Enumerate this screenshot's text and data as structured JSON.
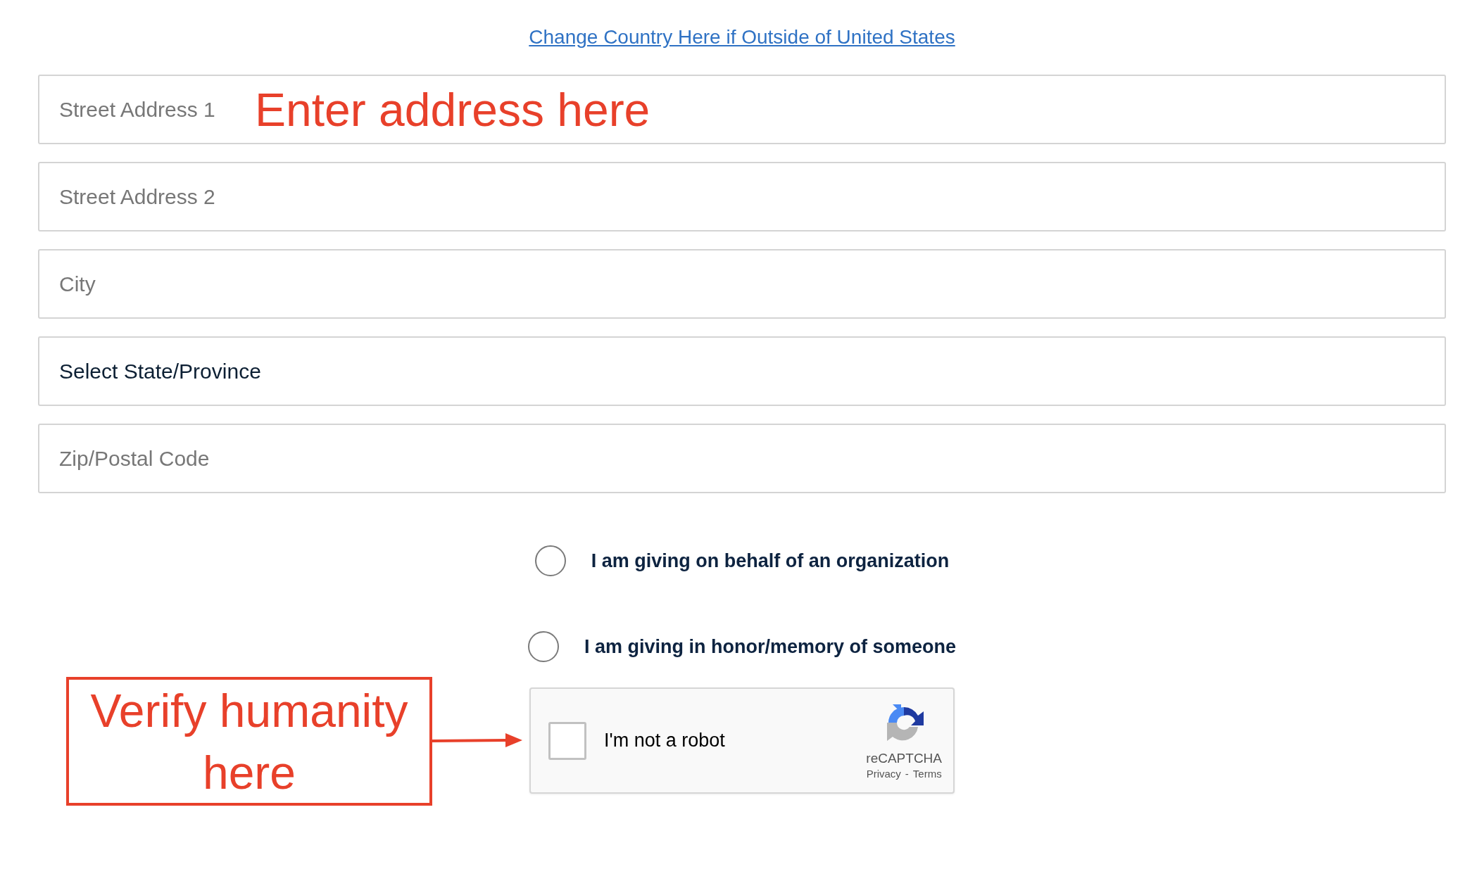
{
  "change_country_link": "Change Country Here if Outside of United States",
  "address_fields": [
    {
      "kind": "input",
      "placeholder": "Street Address 1",
      "annotation": "Enter address here"
    },
    {
      "kind": "input",
      "placeholder": "Street Address 2"
    },
    {
      "kind": "input",
      "placeholder": "City"
    },
    {
      "kind": "select",
      "value": "Select State/Province"
    },
    {
      "kind": "input",
      "placeholder": "Zip/Postal Code"
    }
  ],
  "options": [
    {
      "label": "I am giving on behalf of an organization",
      "selected": false
    },
    {
      "label": "I am giving in honor/memory of someone",
      "selected": false
    }
  ],
  "captcha": {
    "label": "I'm not a robot",
    "checked": false,
    "brand": "reCAPTCHA",
    "privacy": "Privacy",
    "separator": "-",
    "terms": "Terms"
  },
  "captcha_annotation": "Verify humanity here"
}
